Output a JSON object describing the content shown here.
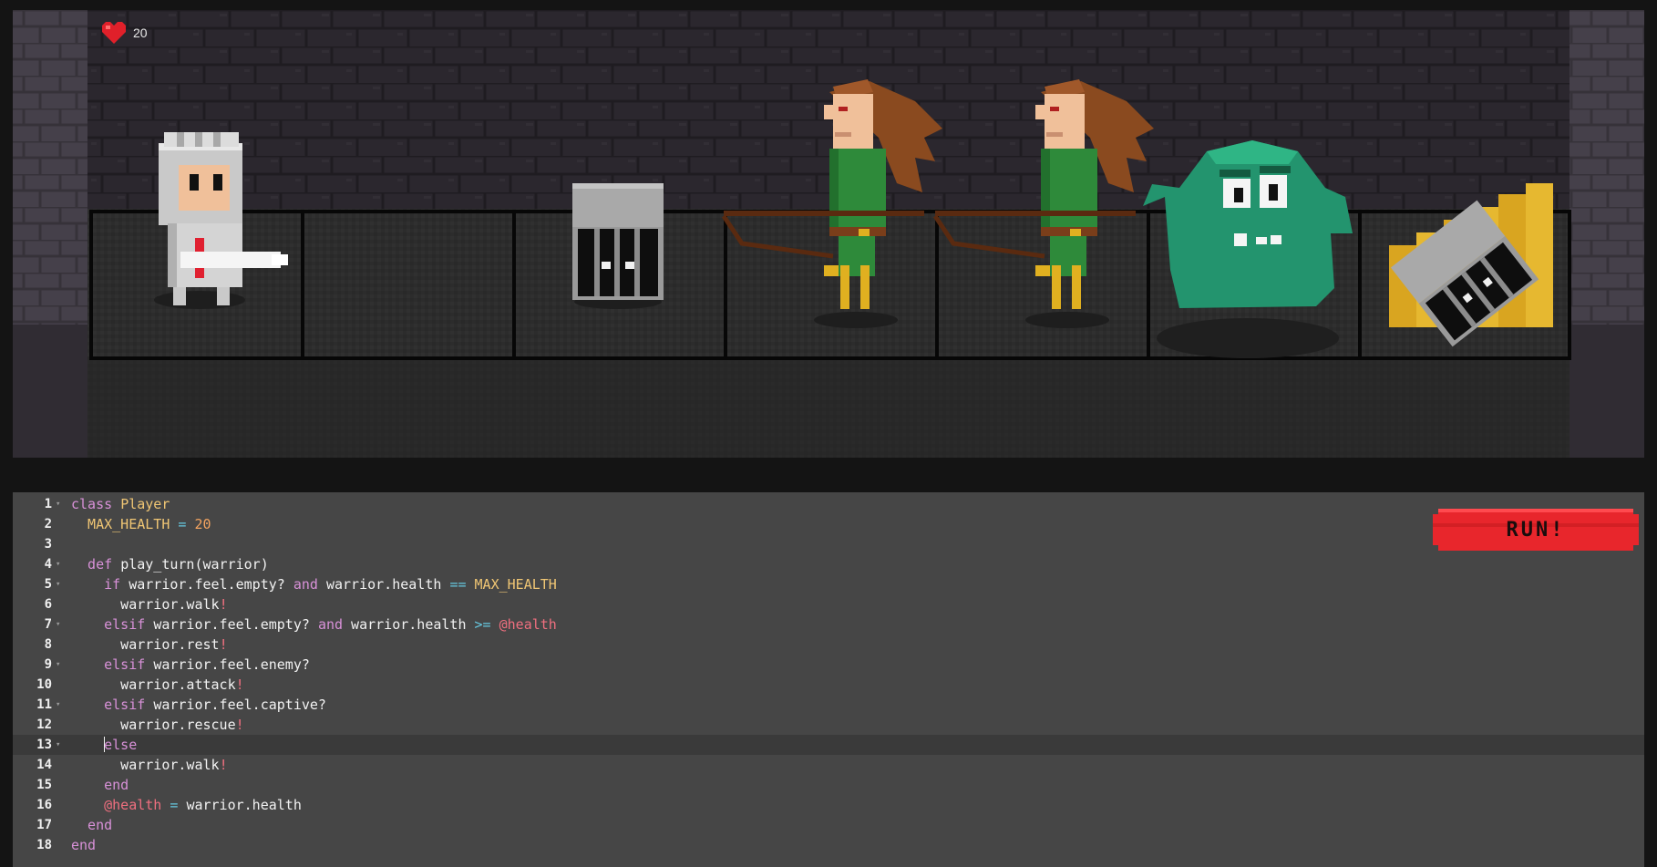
{
  "hud": {
    "health_value": "20",
    "health_icon": "heart-icon"
  },
  "colors": {
    "editor_bg": "#464646",
    "keyword": "#d891d8",
    "class_name": "#f0c674",
    "number": "#f4a460",
    "operator": "#66c8e0",
    "instance_var": "#ef6f7f",
    "run_button": "#e8262c"
  },
  "board": {
    "cells": [
      "warrior",
      "empty",
      "captive",
      "archer",
      "archer",
      "sludge",
      "stairs"
    ]
  },
  "run_button": {
    "label": "RUN!"
  },
  "editor": {
    "active_line": 13,
    "lines": [
      {
        "n": "1",
        "fold": true,
        "tokens": [
          [
            "kw",
            "class "
          ],
          [
            "cls",
            "Player"
          ]
        ]
      },
      {
        "n": "2",
        "fold": false,
        "tokens": [
          [
            "cls",
            "  MAX_HEALTH"
          ],
          [
            "op",
            " = "
          ],
          [
            "num",
            "20"
          ]
        ]
      },
      {
        "n": "3",
        "fold": false,
        "tokens": []
      },
      {
        "n": "4",
        "fold": true,
        "tokens": [
          [
            "kw",
            "  def "
          ],
          [
            "t",
            "play_turn(warrior)"
          ]
        ]
      },
      {
        "n": "5",
        "fold": true,
        "tokens": [
          [
            "kw",
            "    if "
          ],
          [
            "t",
            "warrior.feel.empty? "
          ],
          [
            "kw",
            "and"
          ],
          [
            "t",
            " warrior.health "
          ],
          [
            "op",
            "=="
          ],
          [
            "t",
            " "
          ],
          [
            "cls",
            "MAX_HEALTH"
          ]
        ]
      },
      {
        "n": "6",
        "fold": false,
        "tokens": [
          [
            "t",
            "      warrior.walk"
          ],
          [
            "bang",
            "!"
          ]
        ]
      },
      {
        "n": "7",
        "fold": true,
        "tokens": [
          [
            "kw",
            "    elsif "
          ],
          [
            "t",
            "warrior.feel.empty? "
          ],
          [
            "kw",
            "and"
          ],
          [
            "t",
            " warrior.health "
          ],
          [
            "op",
            ">="
          ],
          [
            "t",
            " "
          ],
          [
            "ivar",
            "@health"
          ]
        ]
      },
      {
        "n": "8",
        "fold": false,
        "tokens": [
          [
            "t",
            "      warrior.rest"
          ],
          [
            "bang",
            "!"
          ]
        ]
      },
      {
        "n": "9",
        "fold": true,
        "tokens": [
          [
            "kw",
            "    elsif "
          ],
          [
            "t",
            "warrior.feel.enemy?"
          ]
        ]
      },
      {
        "n": "10",
        "fold": false,
        "tokens": [
          [
            "t",
            "      warrior.attack"
          ],
          [
            "bang",
            "!"
          ]
        ]
      },
      {
        "n": "11",
        "fold": true,
        "tokens": [
          [
            "kw",
            "    elsif "
          ],
          [
            "t",
            "warrior.feel.captive?"
          ]
        ]
      },
      {
        "n": "12",
        "fold": false,
        "tokens": [
          [
            "t",
            "      warrior.rescue"
          ],
          [
            "bang",
            "!"
          ]
        ]
      },
      {
        "n": "13",
        "fold": true,
        "tokens": [
          [
            "t",
            "    "
          ],
          [
            "cursor",
            ""
          ],
          [
            "kw",
            "else"
          ]
        ]
      },
      {
        "n": "14",
        "fold": false,
        "tokens": [
          [
            "t",
            "      warrior.walk"
          ],
          [
            "bang",
            "!"
          ]
        ]
      },
      {
        "n": "15",
        "fold": false,
        "tokens": [
          [
            "kw",
            "    end"
          ]
        ]
      },
      {
        "n": "16",
        "fold": false,
        "tokens": [
          [
            "ivar",
            "    @health"
          ],
          [
            "op",
            " = "
          ],
          [
            "t",
            "warrior.health"
          ]
        ]
      },
      {
        "n": "17",
        "fold": false,
        "tokens": [
          [
            "kw",
            "  end"
          ]
        ]
      },
      {
        "n": "18",
        "fold": false,
        "tokens": [
          [
            "kw",
            "end"
          ]
        ]
      }
    ]
  }
}
